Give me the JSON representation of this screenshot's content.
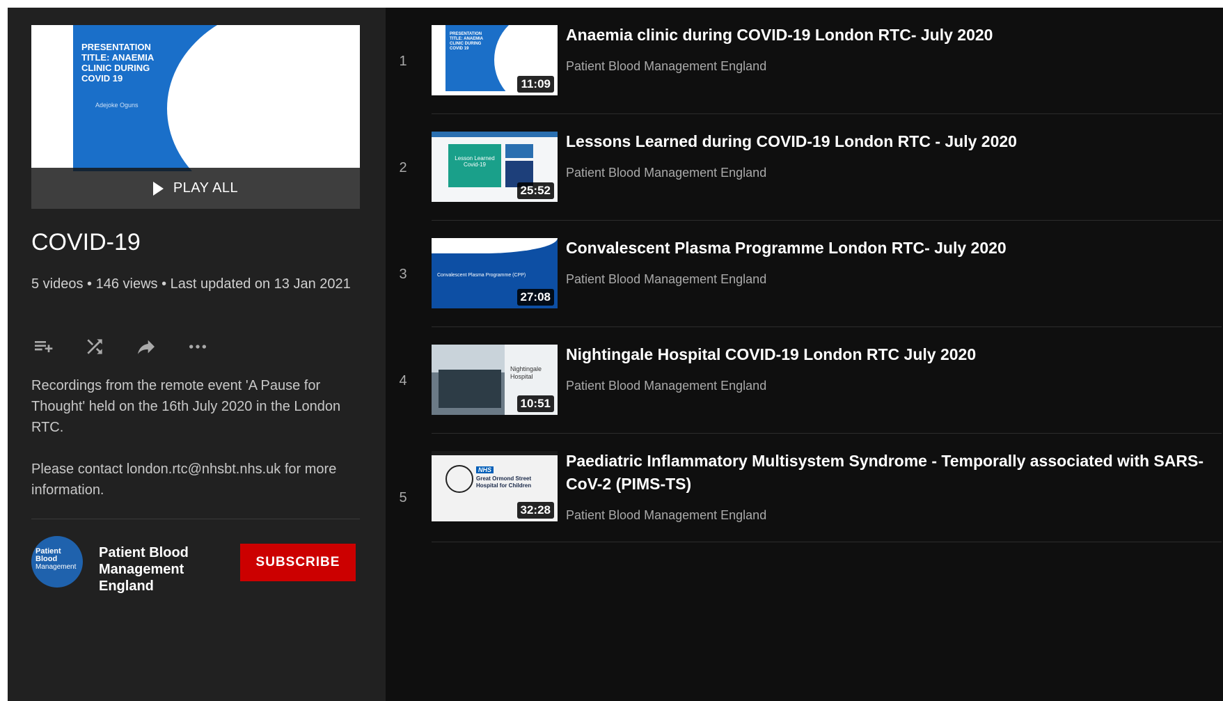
{
  "playlist": {
    "hero_slide_title": "PRESENTATION TITLE: ANAEMIA CLINIC DURING COVID 19",
    "hero_slide_author": "Adejoke Oguns",
    "play_all_label": "PLAY ALL",
    "title": "COVID-19",
    "meta": "5 videos • 146 views • Last updated on 13 Jan 2021",
    "description_1": "Recordings from the remote event 'A Pause for Thought' held on the 16th July 2020 in the London RTC.",
    "description_2": "Please contact london.rtc@nhsbt.nhs.uk for more information.",
    "actions": [
      "add-to-queue-icon",
      "shuffle-icon",
      "share-icon",
      "more-icon"
    ]
  },
  "channel": {
    "avatar_lines": [
      "Patient",
      "Blood",
      "Management"
    ],
    "name": "Patient Blood Management England",
    "subscribe_label": "SUBSCRIBE",
    "subscribe_color": "#cc0000"
  },
  "videos": [
    {
      "index": "1",
      "title": "Anaemia clinic during COVID-19 London RTC- July 2020",
      "channel": "Patient Blood Management England",
      "duration": "11:09"
    },
    {
      "index": "2",
      "title": "Lessons Learned during COVID-19 London RTC - July 2020",
      "channel": "Patient Blood Management England",
      "duration": "25:52",
      "thumb_text": "Lesson Learned Covid-19"
    },
    {
      "index": "3",
      "title": "Convalescent Plasma Programme London RTC- July 2020",
      "channel": "Patient Blood Management England",
      "duration": "27:08",
      "thumb_text": "Convalescent Plasma Programme (CPP)"
    },
    {
      "index": "4",
      "title": "Nightingale Hospital COVID-19 London RTC July 2020",
      "channel": "Patient Blood Management England",
      "duration": "10:51",
      "thumb_text": "Nightingale Hospital"
    },
    {
      "index": "5",
      "title": "Paediatric Inflammatory Multisystem Syndrome - Temporally associated with SARS-CoV-2 (PIMS-TS)",
      "channel": "Patient Blood Management England",
      "duration": "32:28",
      "thumb_nhs": "NHS",
      "thumb_text": "Great Ormond Street Hospital for Children"
    }
  ],
  "colors": {
    "background": "#0f0f0f",
    "sidebar": "#212121",
    "text": "#ffffff",
    "secondary_text": "#aaaaaa"
  }
}
